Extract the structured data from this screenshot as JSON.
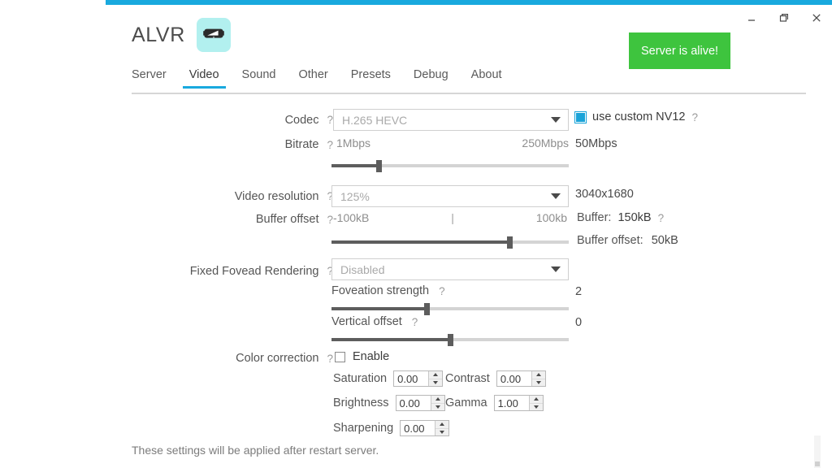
{
  "window": {
    "accent_color": "#19a9de",
    "controls": {
      "minimize": "minimize",
      "restore": "restore",
      "close": "close"
    }
  },
  "header": {
    "app_title": "ALVR",
    "logo_icon": "vr-headset-icon",
    "logo_bg": "#b2f0ef"
  },
  "server_status": {
    "label": "Server is alive!",
    "color": "#3ec43e"
  },
  "tabs": [
    {
      "label": "Server",
      "active": false
    },
    {
      "label": "Video",
      "active": true
    },
    {
      "label": "Sound",
      "active": false
    },
    {
      "label": "Other",
      "active": false
    },
    {
      "label": "Presets",
      "active": false
    },
    {
      "label": "Debug",
      "active": false
    },
    {
      "label": "About",
      "active": false
    }
  ],
  "settings": {
    "codec": {
      "label": "Codec",
      "help": "?",
      "value": "H.265 HEVC",
      "custom_nv12": {
        "label": "use custom NV12",
        "checked": true,
        "help": "?"
      }
    },
    "bitrate": {
      "label": "Bitrate",
      "help": "?",
      "min_label": "1Mbps",
      "max_label": "250Mbps",
      "value_label": "50Mbps",
      "percent": 20
    },
    "video_resolution": {
      "label": "Video resolution",
      "help": "?",
      "value": "125%",
      "result": "3040x1680"
    },
    "buffer_offset": {
      "label": "Buffer offset",
      "help": "?",
      "min_label": "-100kB",
      "max_label": "100kb",
      "center_tick": "|",
      "percent": 75,
      "buffer_label": "Buffer:",
      "buffer_value": "150kB",
      "buffer_help": "?",
      "offset_label": "Buffer offset:",
      "offset_value": "50kB"
    },
    "foveated_rendering": {
      "label": "Fixed Fovead Rendering",
      "help": "?",
      "value": "Disabled",
      "strength": {
        "label": "Foveation strength",
        "help": "?",
        "value": "2",
        "percent": 40
      },
      "vertical_offset": {
        "label": "Vertical offset",
        "help": "?",
        "value": "0",
        "percent": 50
      }
    },
    "color_correction": {
      "label": "Color correction",
      "help": "?",
      "enable_label": "Enable",
      "enable_checked": false,
      "fields": [
        {
          "label": "Saturation",
          "value": "0.00"
        },
        {
          "label": "Contrast",
          "value": "0.00"
        },
        {
          "label": "Brightness",
          "value": "0.00"
        },
        {
          "label": "Gamma",
          "value": "1.00"
        },
        {
          "label": "Sharpening",
          "value": "0.00"
        }
      ]
    }
  },
  "footnote": "These settings will be applied after restart server."
}
